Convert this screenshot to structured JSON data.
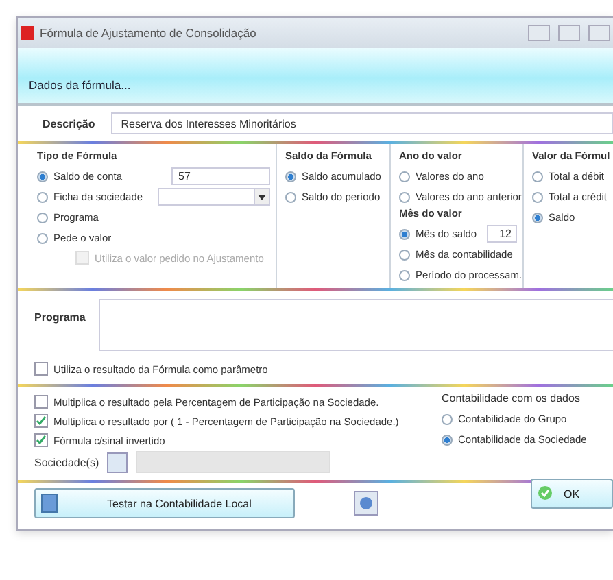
{
  "window": {
    "title": "Fórmula de Ajustamento de Consolidação"
  },
  "header": {
    "title": "Dados da fórmula..."
  },
  "description": {
    "label": "Descrição",
    "value": "Reserva dos Interesses Minoritários"
  },
  "tipo": {
    "title": "Tipo de Fórmula",
    "account_value": "57",
    "options": [
      {
        "label": "Saldo de conta",
        "selected": true
      },
      {
        "label": "Ficha da sociedade",
        "selected": false
      },
      {
        "label": "Programa",
        "selected": false
      },
      {
        "label": "Pede o valor",
        "selected": false
      }
    ],
    "sub_check": {
      "label": "Utiliza o valor pedido no Ajustamento",
      "checked": false,
      "disabled": true
    }
  },
  "saldo": {
    "title": "Saldo da Fórmula",
    "options": [
      {
        "label": "Saldo acumulado",
        "selected": true
      },
      {
        "label": "Saldo do período",
        "selected": false
      }
    ]
  },
  "ano": {
    "title": "Ano do valor",
    "options": [
      {
        "label": "Valores do ano",
        "selected": false
      },
      {
        "label": "Valores do ano anterior",
        "selected": false
      }
    ]
  },
  "mes": {
    "title": "Mês do valor",
    "month_value": "12",
    "options": [
      {
        "label": "Mês do saldo",
        "selected": true
      },
      {
        "label": "Mês da contabilidade",
        "selected": false
      },
      {
        "label": "Período do processam.",
        "selected": false
      }
    ]
  },
  "valor": {
    "title": "Valor da Fórmul",
    "options": [
      {
        "label": "Total a débit",
        "selected": false
      },
      {
        "label": "Total a crédit",
        "selected": false
      },
      {
        "label": "Saldo",
        "selected": true
      }
    ]
  },
  "programa": {
    "label": "Programa"
  },
  "param_check": {
    "label": "Utiliza o resultado da Fórmula como parâmetro",
    "checked": false
  },
  "checks": [
    {
      "label": "Multiplica o resultado pela Percentagem de Participação na Sociedade.",
      "checked": false
    },
    {
      "label": "Multiplica o resultado por ( 1 - Percentagem de Participação na Sociedade.)",
      "checked": true
    },
    {
      "label": "Fórmula c/sinal invertido",
      "checked": true
    }
  ],
  "contabilidade": {
    "title": "Contabilidade com os dados",
    "options": [
      {
        "label": "Contabilidade do Grupo",
        "selected": false
      },
      {
        "label": "Contabilidade da Sociedade",
        "selected": true
      }
    ]
  },
  "sociedades": {
    "label": "Sociedade(s)"
  },
  "buttons": {
    "test": "Testar na Contabilidade Local",
    "ok": "OK"
  }
}
